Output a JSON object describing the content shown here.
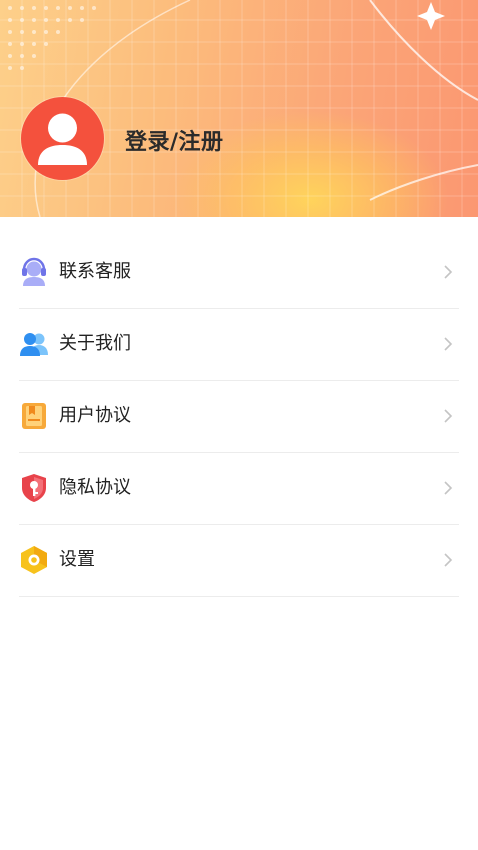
{
  "profile": {
    "login_label": "登录/注册"
  },
  "menu": {
    "items": [
      {
        "label": "联系客服",
        "icon": "customer-service-headset-icon",
        "color": "#8c91f0"
      },
      {
        "label": "关于我们",
        "icon": "users-icon",
        "color": "#3a9cf5"
      },
      {
        "label": "用户协议",
        "icon": "agreement-book-icon",
        "color": "#f5a23a"
      },
      {
        "label": "隐私协议",
        "icon": "privacy-shield-key-icon",
        "color": "#e84b4b"
      },
      {
        "label": "设置",
        "icon": "settings-hexagon-icon",
        "color": "#f4b817"
      }
    ]
  },
  "colors": {
    "header_gradient_start": "#fdd08a",
    "header_gradient_end": "#fb9771",
    "avatar": "#f4513d",
    "divider": "#ececec",
    "chevron": "#c4c4c4"
  }
}
